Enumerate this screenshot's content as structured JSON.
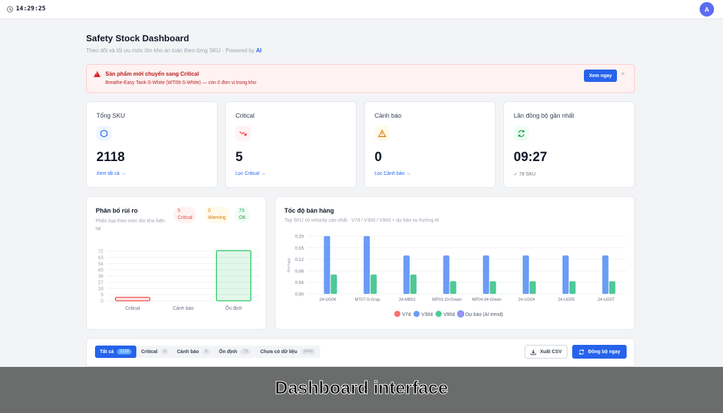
{
  "topbar": {
    "time": "14:29:25",
    "avatar_initial": "A"
  },
  "header": {
    "title": "Safety Stock Dashboard",
    "subtitle": "Theo dõi và tối ưu mức tồn kho an toàn theo từng SKU · Powered by",
    "subtitle_ai": "AI"
  },
  "alert": {
    "title": "Sản phẩm mới chuyển sang Critical",
    "text": "Breathe-Easy Tank-S-White (WT09-S-White) — còn 0 đơn vị trong kho",
    "button": "Xem ngay",
    "close": "×"
  },
  "stats": [
    {
      "label": "Tổng SKU",
      "value": "2118",
      "link": "Xem tất cả →",
      "icon": "cube-icon",
      "color": "#2563eb"
    },
    {
      "label": "Critical",
      "value": "5",
      "link": "Lọc Critical →",
      "icon": "trending-down-icon",
      "color": "#ef4444"
    },
    {
      "label": "Cảnh báo",
      "value": "0",
      "link": "Lọc Cảnh báo →",
      "icon": "warning-icon",
      "color": "#d97706"
    },
    {
      "label": "Lần đồng bộ gần nhất",
      "value": "09:27",
      "note": "✓ 78 SKU",
      "icon": "refresh-icon",
      "color": "#16a34a"
    }
  ],
  "risk": {
    "title": "Phân bố rủi ro",
    "subtitle": "Phân loại theo mức tồn kho hiện tại",
    "pills": [
      {
        "count": "5",
        "label": "Critical"
      },
      {
        "count": "0",
        "label": "Warning"
      },
      {
        "count": "73",
        "label": "OK"
      }
    ]
  },
  "velocity": {
    "title": "Tốc độ bán hàng",
    "subtitle": "Top SKU có velocity cao nhất · V7d / V30d / V90d + dự báo xu hướng AI"
  },
  "chart_data": [
    {
      "type": "bar",
      "title": "Phân bố rủi ro",
      "categories": [
        "Critical",
        "Cảnh báo",
        "Ổn định"
      ],
      "values": [
        5,
        0,
        73
      ],
      "ylim": [
        0,
        81
      ],
      "yticks": [
        0,
        9,
        18,
        27,
        36,
        45,
        54,
        63,
        72
      ],
      "colors": [
        "#ef4444",
        "#f59e0b",
        "#22c55e"
      ],
      "grid": true
    },
    {
      "type": "bar",
      "title": "Tốc độ bán hàng",
      "ylabel": "đơn/ngày",
      "categories": [
        "24-UG06",
        "MT07-S-Gray",
        "24-MB02",
        "MP03-33-Green",
        "MP04-34-Green",
        "24-UG04",
        "24-UG05",
        "24-UG07"
      ],
      "series": [
        {
          "name": "V7d",
          "values": [
            0,
            0,
            0,
            0,
            0,
            0,
            0,
            0
          ],
          "color": "#f87171"
        },
        {
          "name": "V30d",
          "values": [
            0.2,
            0.2,
            0.133,
            0.133,
            0.133,
            0.133,
            0.133,
            0.133
          ],
          "color": "#6b9cf5"
        },
        {
          "name": "V90d",
          "values": [
            0.067,
            0.067,
            0.067,
            0.044,
            0.044,
            0.044,
            0.044,
            0.044
          ],
          "color": "#4ec995"
        }
      ],
      "legend_extra": {
        "name": "Dự báo (AI trend)",
        "color": "#a78bfa"
      },
      "ylim": [
        0,
        0.2
      ],
      "yticks": [
        "0.00",
        "0.04",
        "0.08",
        "0.12",
        "0.16",
        "0.20"
      ],
      "legend": "bottom",
      "grid": true
    }
  ],
  "filters": {
    "tabs": [
      {
        "label": "Tất cả",
        "count": "2118"
      },
      {
        "label": "Critical",
        "count": "5"
      },
      {
        "label": "Cảnh báo",
        "count": "0"
      },
      {
        "label": "Ổn định",
        "count": "73"
      },
      {
        "label": "Chưa có dữ liệu",
        "count": "2040"
      }
    ],
    "export_label": "Xuất CSV",
    "sync_label": "Đồng bộ ngay"
  },
  "overlay": {
    "caption": "Dashboard interface"
  }
}
